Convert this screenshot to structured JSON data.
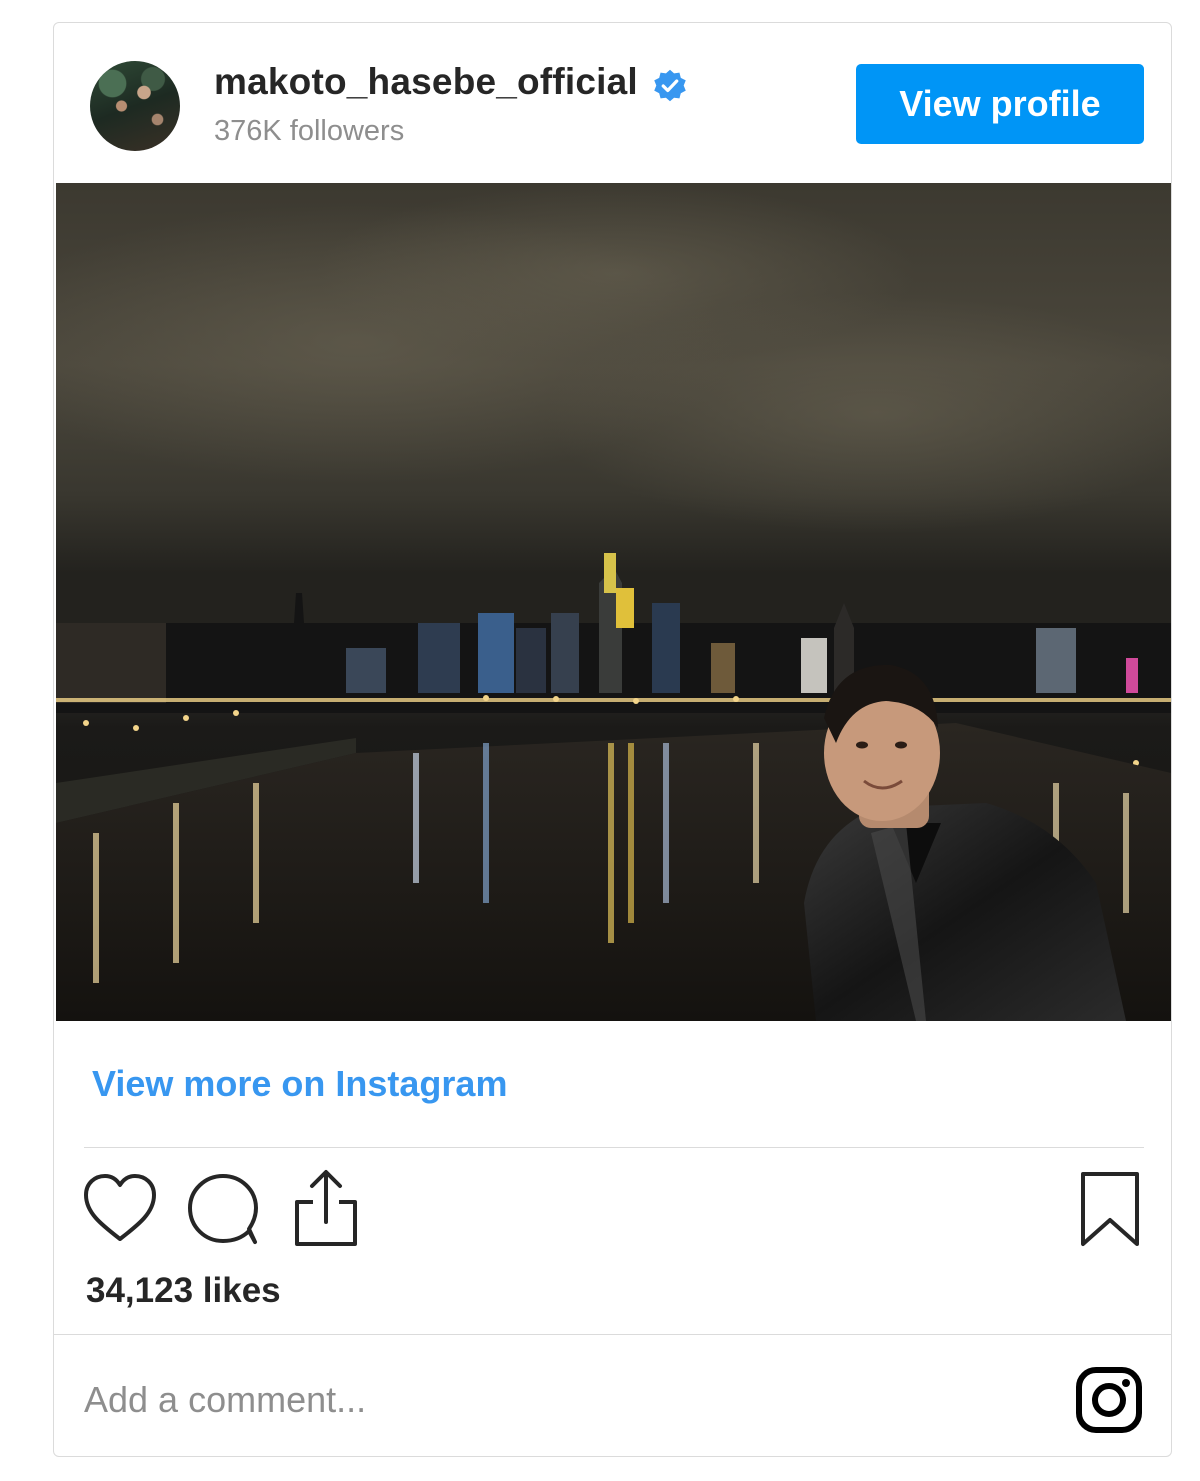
{
  "header": {
    "username": "makoto_hasebe_official",
    "followers": "376K followers",
    "verified": true,
    "view_profile_label": "View profile"
  },
  "post": {
    "view_more_label": "View more on Instagram",
    "likes": "34,123 likes",
    "comment_placeholder": "Add a comment..."
  },
  "icons": {
    "verified": "verified-badge-icon",
    "like": "heart-icon",
    "comment": "speech-bubble-icon",
    "share": "share-icon",
    "save": "bookmark-icon",
    "logo": "instagram-icon"
  },
  "colors": {
    "accent": "#0095f6",
    "link": "#3897f0",
    "muted": "#8e8e8e",
    "border": "#dbdbdb"
  }
}
